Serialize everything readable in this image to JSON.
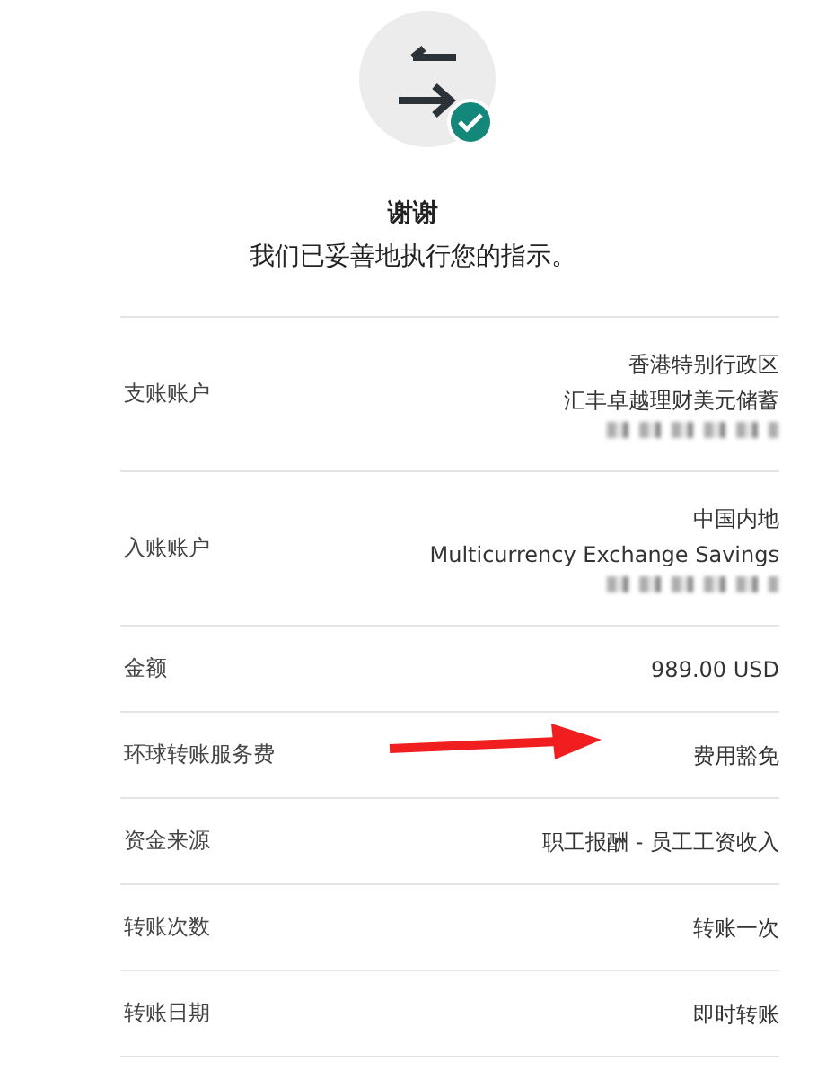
{
  "header": {
    "title": "谢谢",
    "message": "我们已妥善地执行您的指示。"
  },
  "details": [
    {
      "label": "支账账户",
      "lines": [
        "香港特别行政区",
        "汇丰卓越理财美元储蓄"
      ],
      "redacted": true
    },
    {
      "label": "入账账户",
      "lines": [
        "中国内地",
        "Multicurrency Exchange Savings"
      ],
      "redacted": true
    },
    {
      "label": "金额",
      "lines": [
        "989.00 USD"
      ]
    },
    {
      "label": "环球转账服务费",
      "lines": [
        "费用豁免"
      ],
      "annotated": true
    },
    {
      "label": "资金来源",
      "lines": [
        "职工报酬 - 员工工资收入"
      ]
    },
    {
      "label": "转账次数",
      "lines": [
        "转账一次"
      ]
    },
    {
      "label": "转账日期",
      "lines": [
        "即时转账"
      ]
    }
  ]
}
